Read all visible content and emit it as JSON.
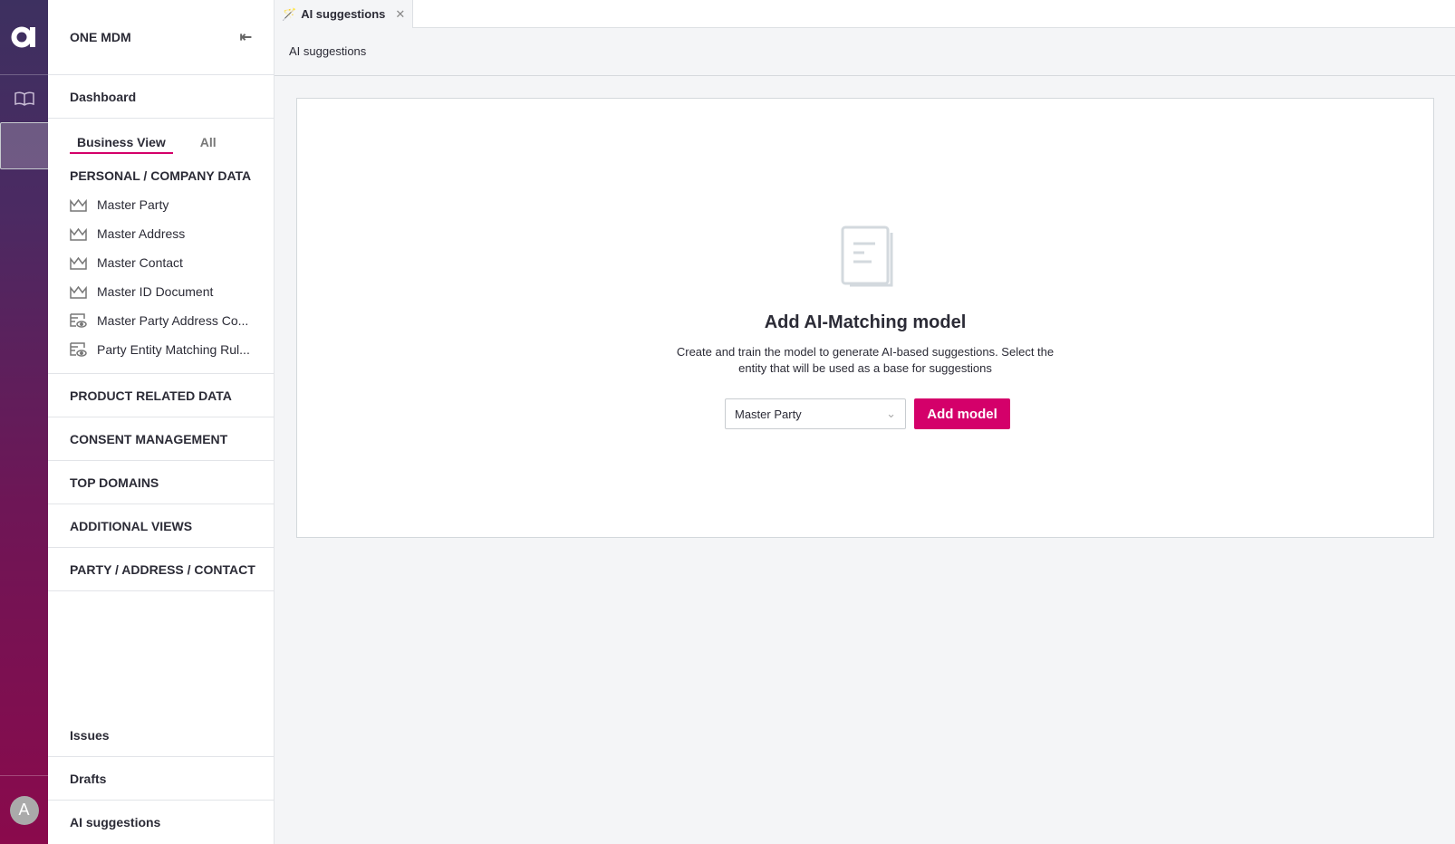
{
  "app": {
    "title": "ONE MDM",
    "accent": "#d4006a"
  },
  "rail": {
    "avatar": "A"
  },
  "sidebar": {
    "dashboard": "Dashboard",
    "tabs": [
      {
        "label": "Business View",
        "active": true
      },
      {
        "label": "All",
        "active": false
      }
    ],
    "section": "PERSONAL / COMPANY DATA",
    "items": [
      {
        "label": "Master Party",
        "icon": "crown-icon"
      },
      {
        "label": "Master Address",
        "icon": "crown-icon"
      },
      {
        "label": "Master Contact",
        "icon": "crown-icon"
      },
      {
        "label": "Master ID Document",
        "icon": "crown-icon"
      },
      {
        "label": "Master Party Address Co...",
        "icon": "view-icon"
      },
      {
        "label": "Party Entity Matching Rul...",
        "icon": "view-icon"
      }
    ],
    "groups": [
      "PRODUCT RELATED DATA",
      "CONSENT MANAGEMENT",
      "TOP DOMAINS",
      "ADDITIONAL VIEWS",
      "PARTY / ADDRESS / CONTACT"
    ],
    "bottom": [
      "Issues",
      "Drafts",
      "AI suggestions"
    ]
  },
  "tab": {
    "label": "AI suggestions"
  },
  "breadcrumb": "AI suggestions",
  "empty": {
    "title": "Add AI-Matching model",
    "line1": "Create and train the model to generate AI-based suggestions. Select the",
    "line2": "entity that will be used as a base for suggestions",
    "select_value": "Master Party",
    "button": "Add model"
  }
}
